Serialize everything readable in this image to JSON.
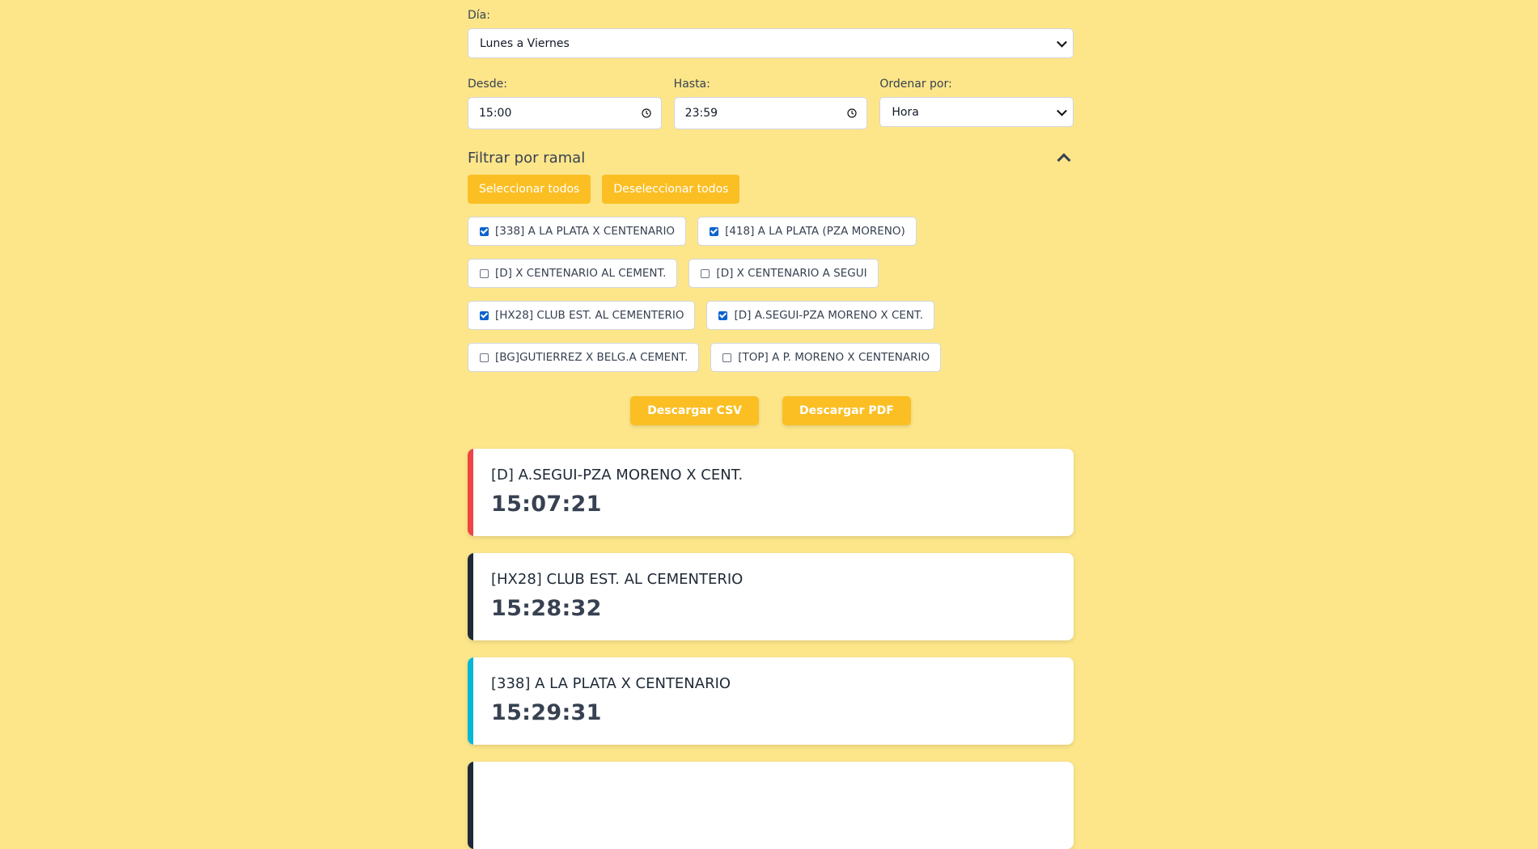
{
  "dia": {
    "label": "Día:",
    "value": "Lunes a Viernes"
  },
  "desde": {
    "label": "Desde:",
    "value": "15:00"
  },
  "hasta": {
    "label": "Hasta:",
    "value": "23:59"
  },
  "ordenar": {
    "label": "Ordenar por:",
    "value": "Hora"
  },
  "filtro": {
    "title": "Filtrar por ramal",
    "select_all": "Seleccionar todos",
    "deselect_all": "Deseleccionar todos",
    "ramales": [
      {
        "label": "[338] A LA PLATA X CENTENARIO",
        "checked": true
      },
      {
        "label": "[418] A LA PLATA (PZA MORENO)",
        "checked": true
      },
      {
        "label": "[D] X CENTENARIO AL CEMENT.",
        "checked": false
      },
      {
        "label": "[D] X CENTENARIO A SEGUI",
        "checked": false
      },
      {
        "label": "[HX28] CLUB EST. AL CEMENTERIO",
        "checked": true
      },
      {
        "label": "[D] A.SEGUI-PZA MORENO X CENT.",
        "checked": true
      },
      {
        "label": "[BG]GUTIERREZ X BELG.A CEMENT.",
        "checked": false
      },
      {
        "label": "[TOP] A P. MORENO X CENTENARIO",
        "checked": false
      }
    ]
  },
  "downloads": {
    "csv": "Descargar CSV",
    "pdf": "Descargar PDF"
  },
  "results": [
    {
      "ramal": "[D] A.SEGUI-PZA MORENO X CENT.",
      "hora": "15:07:21",
      "color": "#ef4444"
    },
    {
      "ramal": "[HX28] CLUB EST. AL CEMENTERIO",
      "hora": "15:28:32",
      "color": "#1f2937"
    },
    {
      "ramal": "[338] A LA PLATA X CENTENARIO",
      "hora": "15:29:31",
      "color": "#06b6d4"
    },
    {
      "ramal": "",
      "hora": "",
      "color": "#1f2937"
    }
  ]
}
